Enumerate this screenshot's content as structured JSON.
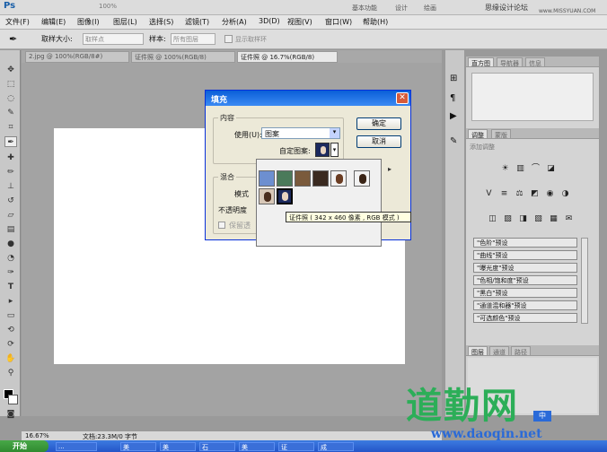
{
  "app": {
    "logo": "Ps",
    "zoom": "100%"
  },
  "topbar": {
    "workspace": "基本功能",
    "design": "设计",
    "paint": "绘画",
    "watermark_top": "思缘设计论坛",
    "watermark_url": "www.MISSYUAN.COM"
  },
  "menu": [
    {
      "label": "文件(F)"
    },
    {
      "label": "编辑(E)"
    },
    {
      "label": "图像(I)"
    },
    {
      "label": "图层(L)"
    },
    {
      "label": "选择(S)"
    },
    {
      "label": "滤镜(T)"
    },
    {
      "label": "分析(A)"
    },
    {
      "label": "3D(D)"
    },
    {
      "label": "视图(V)"
    },
    {
      "label": "窗口(W)"
    },
    {
      "label": "帮助(H)"
    }
  ],
  "options": {
    "sample_size_label": "取样大小:",
    "sample_size_value": "取样点",
    "sample_label": "样本:",
    "sample_value": "所有图层",
    "show_ring": "显示取样环"
  },
  "tabs": [
    {
      "label": "2.jpg @ 100%(RGB/8#)"
    },
    {
      "label": "证件照 @ 100%(RGB/8)"
    },
    {
      "label": "证件照 @ 16.7%(RGB/8)"
    }
  ],
  "status": {
    "zoom": "16.67%",
    "doc": "文档:23.3M/0 字节"
  },
  "dialog": {
    "title": "填充",
    "content_group": "内容",
    "use_label": "使用(U):",
    "use_value": "图案",
    "custom_pattern_label": "自定图案:",
    "blend_group": "混合",
    "mode_label": "模式",
    "opacity_label": "不透明度",
    "preserve_label": "保留透",
    "ok": "确定",
    "cancel": "取消"
  },
  "tooltip": "证件照 ( 342 x 460 像素 , RGB 模式 )",
  "panels": {
    "tabs1": [
      {
        "label": "直方图"
      },
      {
        "label": "导航器"
      },
      {
        "label": "信息"
      }
    ],
    "tabs2": [
      {
        "label": "调整"
      },
      {
        "label": "蒙版"
      }
    ],
    "add_adjust": "添加调整",
    "presets": [
      {
        "label": "\"色阶\"预设"
      },
      {
        "label": "\"曲线\"预设"
      },
      {
        "label": "\"曝光度\"预设"
      },
      {
        "label": "\"色相/饱和度\"预设"
      },
      {
        "label": "\"黑白\"预设"
      },
      {
        "label": "\"通道混和器\"预设"
      },
      {
        "label": "\"可选颜色\"预设"
      }
    ],
    "tabs3": [
      {
        "label": "图层"
      },
      {
        "label": "通道"
      },
      {
        "label": "路径"
      }
    ]
  },
  "taskbar": {
    "start": "开始",
    "items": [
      {
        "label": "..."
      },
      {
        "label": "美"
      },
      {
        "label": "美"
      },
      {
        "label": "石"
      },
      {
        "label": "美"
      },
      {
        "label": "证"
      },
      {
        "label": "成"
      }
    ]
  },
  "ime": "中",
  "watermark": {
    "brand": "道勤网",
    "url": "www.daoqin.net"
  }
}
